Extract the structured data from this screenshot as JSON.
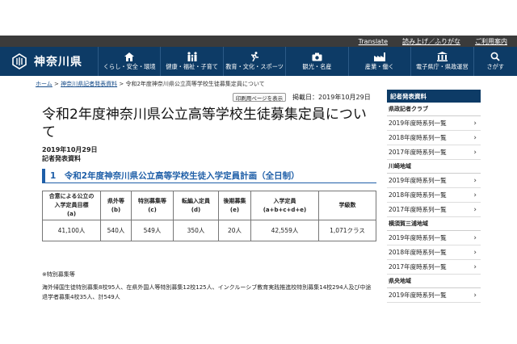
{
  "utility": {
    "translate": "Translate",
    "read_aloud": "読み上げ／ふりがな",
    "help": "ご利用案内"
  },
  "header": {
    "site_name": "神奈川県",
    "nav": [
      {
        "icon": "house-icon",
        "label": "くらし・安全・環境"
      },
      {
        "icon": "family-icon",
        "label": "健康・福祉・子育て"
      },
      {
        "icon": "runner-icon",
        "label": "教育・文化・スポーツ"
      },
      {
        "icon": "camera-icon",
        "label": "観光・名産"
      },
      {
        "icon": "factory-icon",
        "label": "産業・働く"
      },
      {
        "icon": "building-icon",
        "label": "電子県庁・県政運営"
      },
      {
        "icon": "search-icon",
        "label": "さがす"
      }
    ]
  },
  "breadcrumb": {
    "home": "ホーム",
    "sep1": " > ",
    "parent": "神奈川県記者発表資料",
    "sep2": " > ",
    "current": "令和2年度神奈川県公立高等学校生徒募集定員について"
  },
  "article": {
    "print_label": "印刷用ページを表示",
    "posted": "掲載日：2019年10月29日",
    "title": "令和2年度神奈川県公立高等学校生徒募集定員について",
    "date": "2019年10月29日",
    "doc_type": "記者発表資料",
    "section_heading": "1　令和2年度神奈川県公立高等学校生徒入学定員計画（全日制）",
    "table": {
      "headers": [
        [
          "合意による公立の",
          "入学定員目標",
          "(a)"
        ],
        [
          "県外等",
          "(b)"
        ],
        [
          "特別募集等",
          "(c)"
        ],
        [
          "転編入定員",
          "(d)"
        ],
        [
          "後期募集",
          "(e)"
        ],
        [
          "入学定員",
          "(a+b+c+d+e)"
        ],
        [
          "学級数"
        ]
      ],
      "row": [
        "41,100人",
        "540人",
        "549人",
        "350人",
        "20人",
        "42,559人",
        "1,071クラス"
      ]
    },
    "note_heading": "※特別募集等",
    "note_text": "海外帰国生徒特別募集8校95人、在県外国人等特別募集12校125人、インクルーシブ教育実践推進校特別募集14校294人及び中途退学者募集4校35人、計549人"
  },
  "sidebar": {
    "heading": "記者発表資料",
    "groups": [
      {
        "name": "県政記者クラブ",
        "links": [
          "2019年度時系列一覧",
          "2018年度時系列一覧",
          "2017年度時系列一覧"
        ]
      },
      {
        "name": "川崎地域",
        "links": [
          "2019年度時系列一覧",
          "2018年度時系列一覧",
          "2017年度時系列一覧"
        ]
      },
      {
        "name": "横須賀三浦地域",
        "links": [
          "2019年度時系列一覧",
          "2018年度時系列一覧",
          "2017年度時系列一覧"
        ]
      },
      {
        "name": "県央地域",
        "links": [
          "2019年度時系列一覧"
        ]
      }
    ]
  },
  "colors": {
    "header_bg": "#0d3b66",
    "utility_bg": "#3b3b3b",
    "accent": "#1f5fa8"
  }
}
